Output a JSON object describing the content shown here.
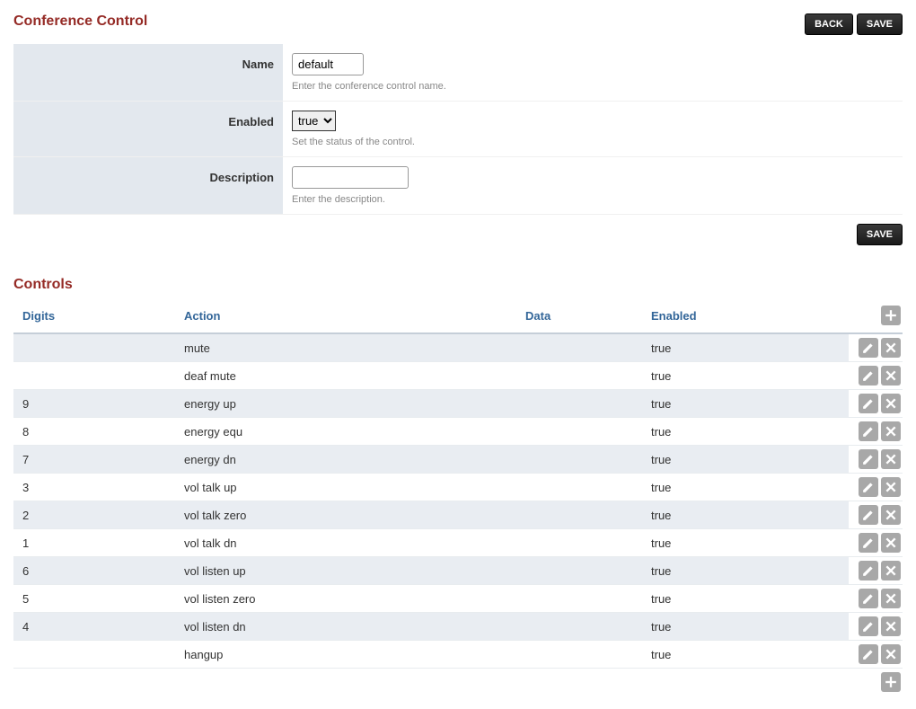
{
  "page": {
    "title": "Conference Control",
    "buttons": {
      "back": "BACK",
      "save": "SAVE"
    }
  },
  "form": {
    "name": {
      "label": "Name",
      "value": "default",
      "hint": "Enter the conference control name."
    },
    "enabled": {
      "label": "Enabled",
      "value": "true",
      "hint": "Set the status of the control.",
      "options": [
        "true",
        "false"
      ]
    },
    "description": {
      "label": "Description",
      "value": "",
      "hint": "Enter the description."
    },
    "save": "SAVE"
  },
  "section": {
    "title": "Controls"
  },
  "table": {
    "headers": {
      "digits": "Digits",
      "action": "Action",
      "data": "Data",
      "enabled": "Enabled"
    },
    "rows": [
      {
        "digits": "",
        "action": "mute",
        "data": "",
        "enabled": "true"
      },
      {
        "digits": "",
        "action": "deaf mute",
        "data": "",
        "enabled": "true"
      },
      {
        "digits": "9",
        "action": "energy up",
        "data": "",
        "enabled": "true"
      },
      {
        "digits": "8",
        "action": "energy equ",
        "data": "",
        "enabled": "true"
      },
      {
        "digits": "7",
        "action": "energy dn",
        "data": "",
        "enabled": "true"
      },
      {
        "digits": "3",
        "action": "vol talk up",
        "data": "",
        "enabled": "true"
      },
      {
        "digits": "2",
        "action": "vol talk zero",
        "data": "",
        "enabled": "true"
      },
      {
        "digits": "1",
        "action": "vol talk dn",
        "data": "",
        "enabled": "true"
      },
      {
        "digits": "6",
        "action": "vol listen up",
        "data": "",
        "enabled": "true"
      },
      {
        "digits": "5",
        "action": "vol listen zero",
        "data": "",
        "enabled": "true"
      },
      {
        "digits": "4",
        "action": "vol listen dn",
        "data": "",
        "enabled": "true"
      },
      {
        "digits": "",
        "action": "hangup",
        "data": "",
        "enabled": "true"
      }
    ]
  }
}
